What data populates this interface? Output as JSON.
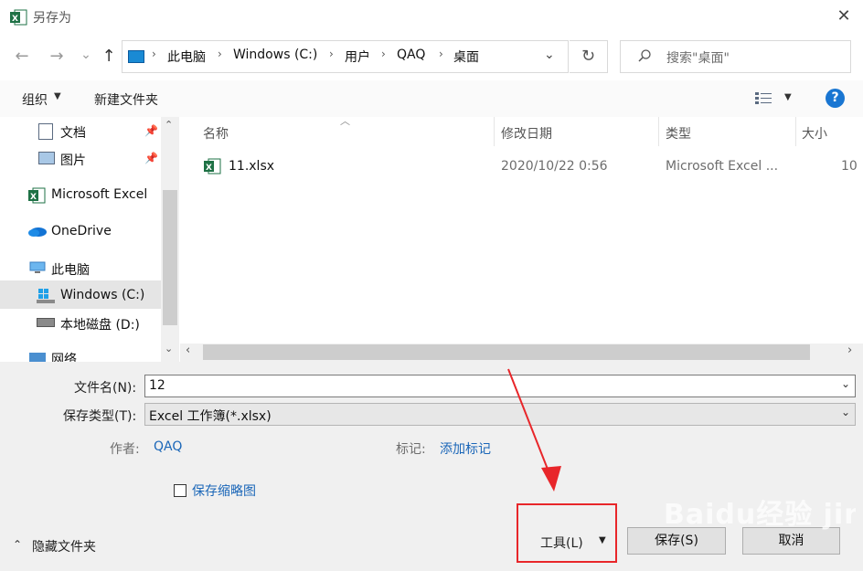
{
  "window": {
    "title": "另存为",
    "close_glyph": "✕"
  },
  "nav": {
    "back": "←",
    "forward": "→",
    "recent": "⌄",
    "up": "↑",
    "refresh": "↻"
  },
  "breadcrumb": [
    "此电脑",
    "Windows (C:)",
    "用户",
    "QAQ",
    "桌面"
  ],
  "search": {
    "placeholder": "搜索\"桌面\""
  },
  "toolbar": {
    "organize": "组织",
    "new_folder": "新建文件夹",
    "help": "?"
  },
  "sidebar": {
    "items": [
      {
        "label": "文档",
        "icon": "document-icon",
        "pinned": true
      },
      {
        "label": "图片",
        "icon": "picture-icon",
        "pinned": true
      },
      {
        "label": "Microsoft Excel",
        "icon": "excel-icon"
      },
      {
        "label": "OneDrive",
        "icon": "onedrive-icon"
      },
      {
        "label": "此电脑",
        "icon": "computer-icon"
      },
      {
        "label": "Windows (C:)",
        "icon": "windows-drive-icon",
        "selected": true
      },
      {
        "label": "本地磁盘 (D:)",
        "icon": "drive-icon"
      },
      {
        "label": "网络",
        "icon": "network-icon"
      }
    ]
  },
  "file_list": {
    "columns": [
      "名称",
      "修改日期",
      "类型",
      "大小"
    ],
    "rows": [
      {
        "name": "11.xlsx",
        "modified": "2020/10/22 0:56",
        "type": "Microsoft Excel ...",
        "size": "10"
      }
    ]
  },
  "form": {
    "filename_label": "文件名(N):",
    "filename_value": "12",
    "filetype_label": "保存类型(T):",
    "filetype_value": "Excel 工作簿(*.xlsx)",
    "author_label": "作者:",
    "author_value": "QAQ",
    "tags_label": "标记:",
    "tags_value": "添加标记",
    "thumbnail_label": "保存缩略图"
  },
  "footer": {
    "hide_folders": "隐藏文件夹",
    "tools": "工具(L)",
    "save": "保存(S)",
    "cancel": "取消"
  },
  "watermark": "Baidu经验 jingyan.baidu.com",
  "colors": {
    "accent": "#1a66b8",
    "annotation": "#e8262a",
    "excel_green": "#1e7145",
    "help_blue": "#1976d2"
  }
}
